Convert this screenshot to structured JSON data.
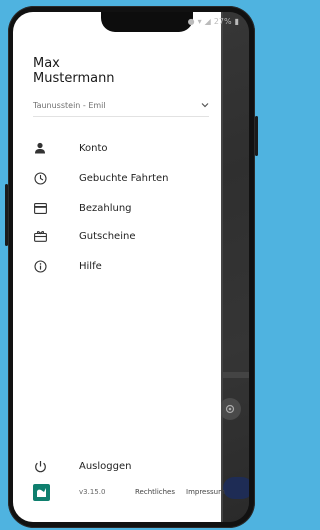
{
  "status_bar": {
    "battery": "27%"
  },
  "user": {
    "first_name": "Max",
    "last_name": "Mustermann"
  },
  "location": {
    "selected": "Taunusstein - Emil"
  },
  "menu": [
    {
      "label": "Konto",
      "icon": "person-icon"
    },
    {
      "label": "Gebuchte Fahrten",
      "icon": "clock-icon"
    },
    {
      "label": "Bezahlung",
      "icon": "credit-card-icon"
    },
    {
      "label": "Gutscheine",
      "icon": "voucher-icon"
    },
    {
      "label": "Hilfe",
      "icon": "info-icon"
    }
  ],
  "logout": {
    "label": "Ausloggen",
    "icon": "power-icon"
  },
  "footer": {
    "version": "v3.15.0",
    "legal": "Rechtliches",
    "imprint": "Impressum"
  },
  "colors": {
    "background": "#4fb3e0",
    "logo": "#0f7f6e",
    "text": "#1f1f1f"
  }
}
